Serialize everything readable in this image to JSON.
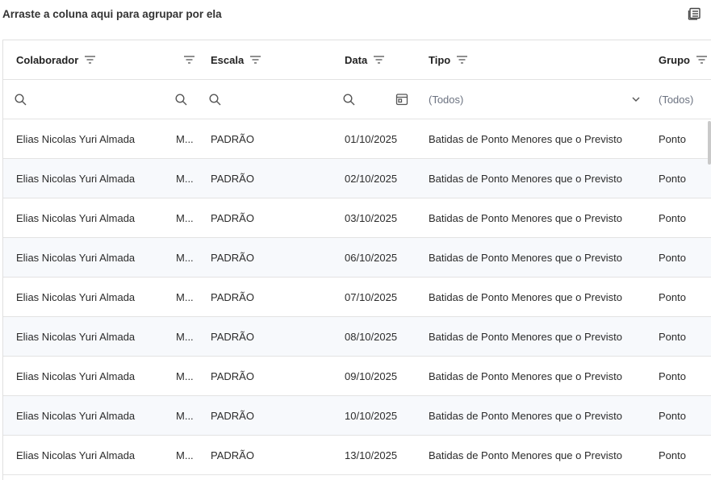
{
  "group_panel": {
    "text": "Arraste a coluna aqui para agrupar por ela"
  },
  "columns": [
    {
      "id": "colaborador",
      "label": "Colaborador"
    },
    {
      "id": "m",
      "label": ""
    },
    {
      "id": "escala",
      "label": "Escala"
    },
    {
      "id": "data",
      "label": "Data"
    },
    {
      "id": "tipo",
      "label": "Tipo"
    },
    {
      "id": "grupo",
      "label": "Grupo"
    }
  ],
  "filters": {
    "tipo_value": "(Todos)",
    "grupo_value": "(Todos)"
  },
  "rows": [
    {
      "colaborador": "Elias Nicolas Yuri Almada",
      "m": "M...",
      "escala": "PADRÃO",
      "data": "01/10/2025",
      "tipo": "Batidas de Ponto Menores que o Previsto",
      "grupo": "Ponto"
    },
    {
      "colaborador": "Elias Nicolas Yuri Almada",
      "m": "M...",
      "escala": "PADRÃO",
      "data": "02/10/2025",
      "tipo": "Batidas de Ponto Menores que o Previsto",
      "grupo": "Ponto"
    },
    {
      "colaborador": "Elias Nicolas Yuri Almada",
      "m": "M...",
      "escala": "PADRÃO",
      "data": "03/10/2025",
      "tipo": "Batidas de Ponto Menores que o Previsto",
      "grupo": "Ponto"
    },
    {
      "colaborador": "Elias Nicolas Yuri Almada",
      "m": "M...",
      "escala": "PADRÃO",
      "data": "06/10/2025",
      "tipo": "Batidas de Ponto Menores que o Previsto",
      "grupo": "Ponto"
    },
    {
      "colaborador": "Elias Nicolas Yuri Almada",
      "m": "M...",
      "escala": "PADRÃO",
      "data": "07/10/2025",
      "tipo": "Batidas de Ponto Menores que o Previsto",
      "grupo": "Ponto"
    },
    {
      "colaborador": "Elias Nicolas Yuri Almada",
      "m": "M...",
      "escala": "PADRÃO",
      "data": "08/10/2025",
      "tipo": "Batidas de Ponto Menores que o Previsto",
      "grupo": "Ponto"
    },
    {
      "colaborador": "Elias Nicolas Yuri Almada",
      "m": "M...",
      "escala": "PADRÃO",
      "data": "09/10/2025",
      "tipo": "Batidas de Ponto Menores que o Previsto",
      "grupo": "Ponto"
    },
    {
      "colaborador": "Elias Nicolas Yuri Almada",
      "m": "M...",
      "escala": "PADRÃO",
      "data": "10/10/2025",
      "tipo": "Batidas de Ponto Menores que o Previsto",
      "grupo": "Ponto"
    },
    {
      "colaborador": "Elias Nicolas Yuri Almada",
      "m": "M...",
      "escala": "PADRÃO",
      "data": "13/10/2025",
      "tipo": "Batidas de Ponto Menores que o Previsto",
      "grupo": "Ponto"
    }
  ]
}
